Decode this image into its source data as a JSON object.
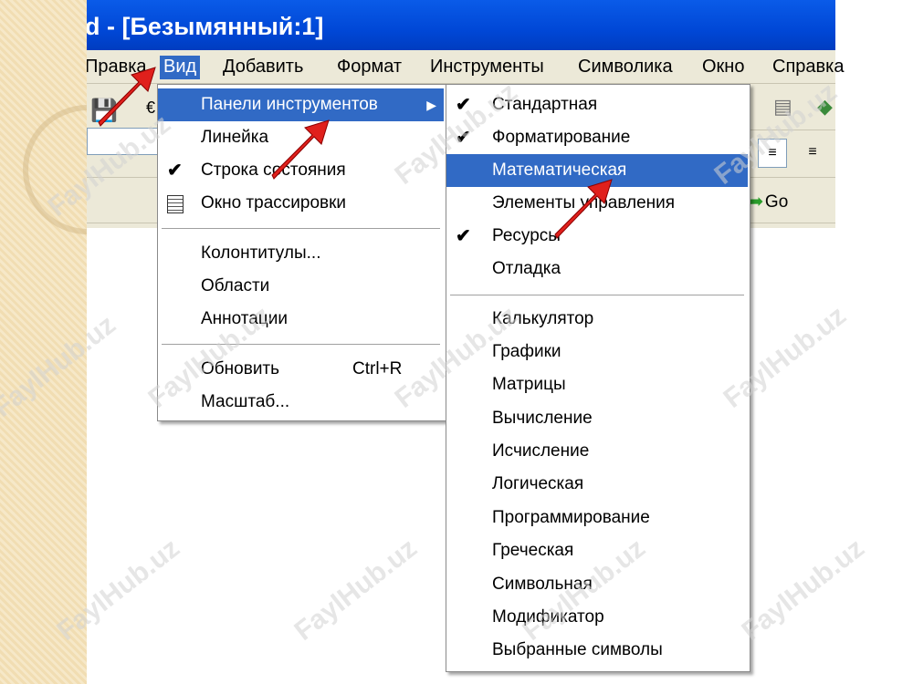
{
  "window": {
    "title": "d - [Безымянный:1]"
  },
  "menubar": {
    "items": [
      {
        "label": "Правка",
        "id": "edit"
      },
      {
        "label": "Вид",
        "id": "view",
        "active": true
      },
      {
        "label": "Добавить",
        "id": "insert"
      },
      {
        "label": "Формат",
        "id": "format"
      },
      {
        "label": "Инструменты",
        "id": "tools"
      },
      {
        "label": "Символика",
        "id": "symbolics"
      },
      {
        "label": "Окно",
        "id": "window"
      },
      {
        "label": "Справка",
        "id": "help"
      }
    ]
  },
  "toolbar": {
    "go_label": "Go"
  },
  "view_menu": {
    "items": [
      {
        "label": "Панели инструментов",
        "submenu": true,
        "highlighted": true
      },
      {
        "label": "Линейка"
      },
      {
        "label": "Строка состояния",
        "checked": true
      },
      {
        "label": "Окно трассировки",
        "icon": "trace-window-icon"
      },
      {
        "label": "Колонтитулы..."
      },
      {
        "label": "Области"
      },
      {
        "label": "Аннотации"
      },
      {
        "label": "Обновить",
        "shortcut": "Ctrl+R"
      },
      {
        "label": "Масштаб..."
      }
    ]
  },
  "toolbars_submenu": {
    "items": [
      {
        "label": "Стандартная",
        "checked": true
      },
      {
        "label": "Форматирование",
        "checked": true
      },
      {
        "label": "Математическая",
        "highlighted": true
      },
      {
        "label": "Элементы управления"
      },
      {
        "label": "Ресурсы",
        "checked": true
      },
      {
        "label": "Отладка"
      },
      {
        "label": "Калькулятор"
      },
      {
        "label": "Графики"
      },
      {
        "label": "Матрицы"
      },
      {
        "label": "Вычисление"
      },
      {
        "label": "Исчисление"
      },
      {
        "label": "Логическая"
      },
      {
        "label": "Программирование"
      },
      {
        "label": "Греческая"
      },
      {
        "label": "Символьная"
      },
      {
        "label": "Модификатор"
      },
      {
        "label": "Выбранные символы"
      }
    ]
  },
  "watermark": "FaylHub.uz",
  "colors": {
    "titlebar": "#0047d6",
    "highlight": "#316ac5",
    "menubar": "#ece9d8",
    "arrow": "#e0201c"
  }
}
